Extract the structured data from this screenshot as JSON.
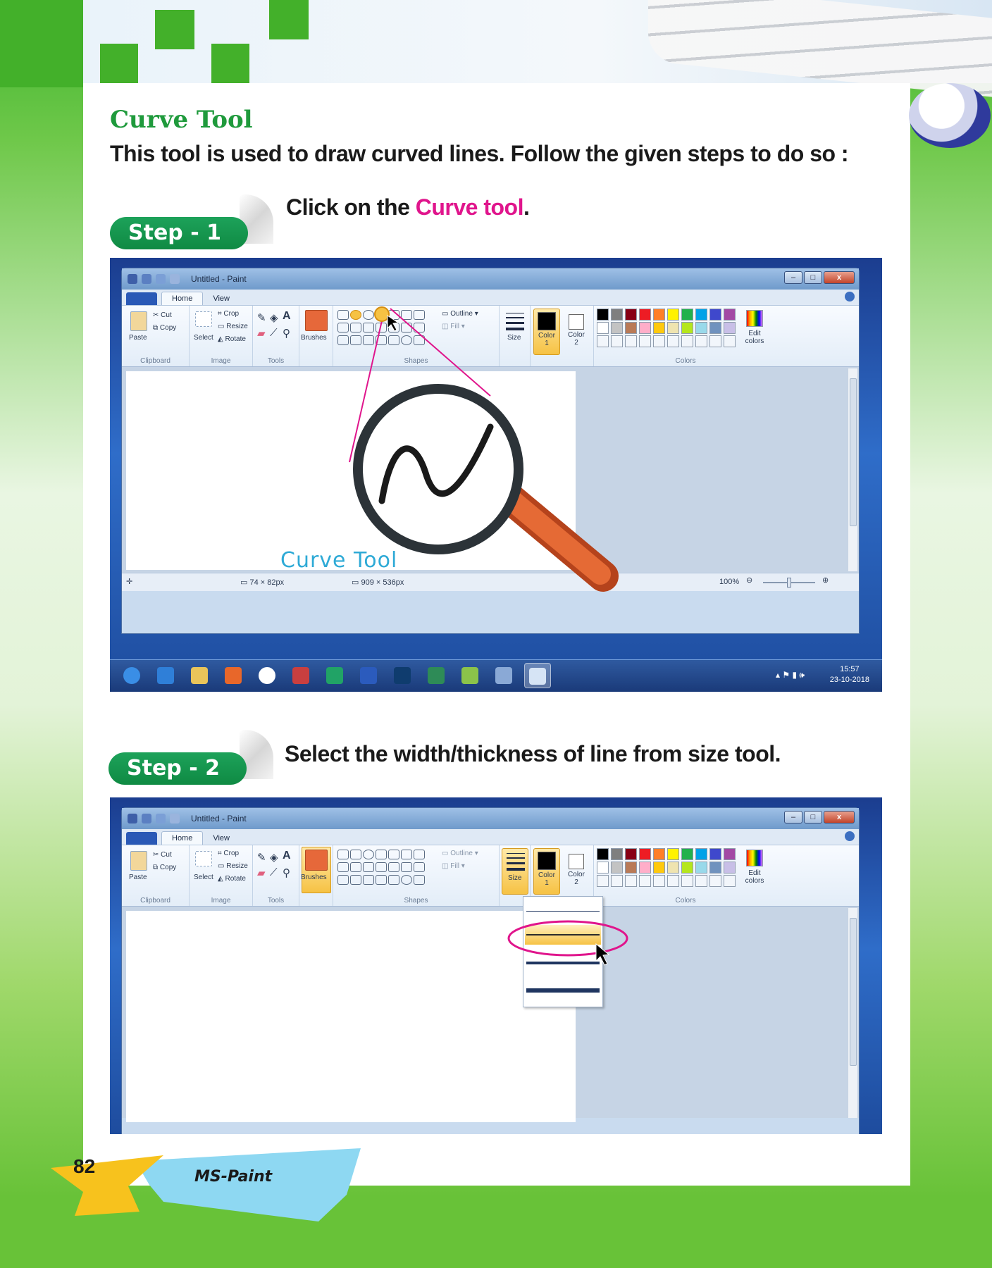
{
  "page": {
    "heading": "Curve Tool",
    "intro": "This tool is used to draw curved lines. Follow the given steps to do so :",
    "page_number": "82",
    "chapter": "MS-Paint"
  },
  "steps": [
    {
      "badge": "Step - 1",
      "text_before": "Click on the ",
      "text_highlight": "Curve tool",
      "text_after": "."
    },
    {
      "badge": "Step - 2",
      "text": "Select the width/thickness of line from size tool."
    }
  ],
  "paint_window": {
    "title": "Untitled - Paint",
    "tabs": [
      "Home",
      "View"
    ],
    "clipboard": {
      "paste": "Paste",
      "cut": "Cut",
      "copy": "Copy",
      "group": "Clipboard"
    },
    "image": {
      "select": "Select",
      "crop": "Crop",
      "resize": "Resize",
      "rotate": "Rotate",
      "group": "Image"
    },
    "tools": {
      "group": "Tools"
    },
    "brushes": "Brushes",
    "shapes": {
      "outline": "Outline",
      "fill": "Fill",
      "group": "Shapes"
    },
    "size": "Size",
    "color1": "Color",
    "color1_num": "1",
    "color2": "Color",
    "color2_num": "2",
    "colors_group": "Colors",
    "edit_colors": "Edit colors",
    "status": {
      "selection": "74 × 82px",
      "canvas_size": "909 × 536px",
      "zoom": "100%"
    },
    "zoom_level": 0.5
  },
  "callout": {
    "label": "Curve Tool"
  },
  "palette": [
    "#000000",
    "#7f7f7f",
    "#880015",
    "#ed1c24",
    "#ff7f27",
    "#fff200",
    "#22b14c",
    "#00a2e8",
    "#3f48cc",
    "#a349a4",
    "#ffffff",
    "#c3c3c3",
    "#b97a57",
    "#ffaec9",
    "#ffc90e",
    "#efe4b0",
    "#b5e61d",
    "#99d9ea",
    "#7092be",
    "#c8bfe7"
  ],
  "taskbar": {
    "time": "15:57",
    "date": "23-10-2018",
    "apps": [
      "start-orb",
      "internet-explorer",
      "file-explorer",
      "media-player",
      "chrome",
      "paper-plane",
      "excel",
      "word",
      "photoshop",
      "app-green",
      "app-notes",
      "app-misc",
      "paint"
    ],
    "active_app": "paint"
  }
}
